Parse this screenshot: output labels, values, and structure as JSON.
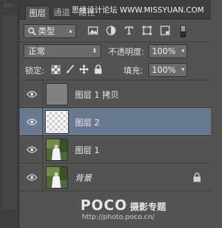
{
  "tabs": [
    {
      "label": "图层"
    },
    {
      "label": "通道"
    },
    {
      "label": "路径"
    }
  ],
  "watermark": "思缘设计论坛 WWW.MISSYUAN.COM",
  "filter": {
    "selected": "类型"
  },
  "blend": {
    "mode": "正常",
    "opacity_label": "不透明度:",
    "opacity_value": "100%"
  },
  "lock": {
    "label": "锁定:",
    "fill_label": "填充:",
    "fill_value": "100%"
  },
  "layers": [
    {
      "name": "图层 1 拷贝",
      "thumb": "gray"
    },
    {
      "name": "图层 2",
      "thumb": "transparent",
      "selected": true
    },
    {
      "name": "图层 1",
      "thumb": "photo"
    },
    {
      "name": "背景",
      "thumb": "photo",
      "locked": true
    }
  ],
  "footer": {
    "brand": "POCO",
    "brand_zh": "摄影专题",
    "url": "http://photo.poco.cn/"
  },
  "colors": {
    "panel": "#535353",
    "selected_row": "#69798f",
    "tab_bar": "#3e3e3e"
  }
}
